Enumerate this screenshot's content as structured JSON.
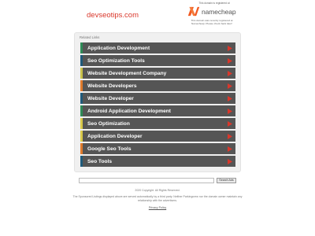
{
  "site": {
    "title": "devseotips.com"
  },
  "registrar": {
    "note": "This domain is registered at",
    "name": "namecheap",
    "description": "This domain was recently registered at Namecheap. Please check back later!"
  },
  "colors": {
    "accent": "#d9372b",
    "row_background": "#555555",
    "namecheap_orange": "#f15a22"
  },
  "related_links": {
    "heading": "Related Links",
    "items": [
      {
        "label": "Application Development",
        "accent": "#2e8b57"
      },
      {
        "label": "Seo Optimization Tools",
        "accent": "#1f5a7a"
      },
      {
        "label": "Website Development Company",
        "accent": "#c9c24a"
      },
      {
        "label": "Website Developers",
        "accent": "#e07b2c"
      },
      {
        "label": "Website Developer",
        "accent": "#1f5a7a"
      },
      {
        "label": "Android Application Development",
        "accent": "#2e8b57"
      },
      {
        "label": "Seo Optimization",
        "accent": "#d9c94a"
      },
      {
        "label": "Application Developer",
        "accent": "#d9c94a"
      },
      {
        "label": "Google Seo Tools",
        "accent": "#e07b2c"
      },
      {
        "label": "Seo Tools",
        "accent": "#1f5a7a"
      }
    ]
  },
  "search": {
    "placeholder": "",
    "button_label": "Search Ads"
  },
  "footer": {
    "copyright": "2020 Copyright. All Rights Reserved.",
    "disclaimer_line1": "The Sponsored Listings displayed above are served automatically by a third party. Neither Parkingcrew nor the domain owner maintain any",
    "disclaimer_line2": "relationship with the advertisers.",
    "privacy_label": "Privacy Policy"
  }
}
